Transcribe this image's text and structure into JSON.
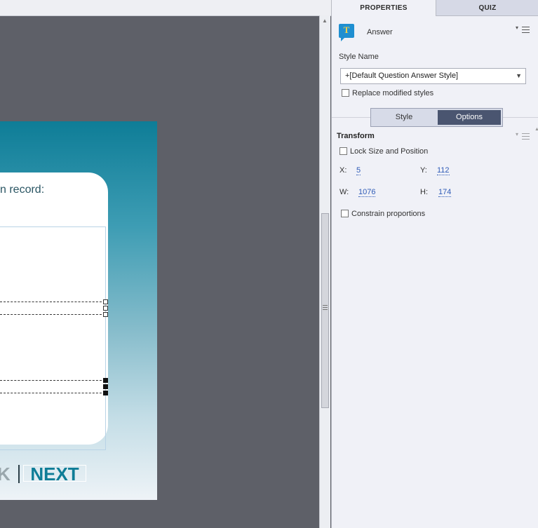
{
  "canvas": {
    "question_text": "n record:",
    "nav": {
      "back_fragment": "K",
      "next_label": "NEXT"
    }
  },
  "panel": {
    "tabs": [
      {
        "label": "PROPERTIES",
        "active": true
      },
      {
        "label": "QUIZ",
        "active": false
      }
    ],
    "object": {
      "name": "Answer",
      "icon": "text-caption-icon"
    },
    "style_name": {
      "label": "Style Name",
      "value": "+[Default Question Answer Style]",
      "replace_modified_label": "Replace modified styles",
      "replace_modified_checked": false
    },
    "segments": {
      "style_label": "Style",
      "options_label": "Options",
      "active": "Options"
    },
    "transform": {
      "title": "Transform",
      "lock_label": "Lock Size and Position",
      "lock_checked": false,
      "x_label": "X:",
      "x_value": "5",
      "y_label": "Y:",
      "y_value": "112",
      "w_label": "W:",
      "w_value": "1076",
      "h_label": "H:",
      "h_value": "174",
      "constrain_label": "Constrain proportions",
      "constrain_checked": false
    }
  },
  "colors": {
    "accent": "#0e7d97",
    "segment_active": "#4a5570",
    "value_link": "#2f5bb7"
  }
}
